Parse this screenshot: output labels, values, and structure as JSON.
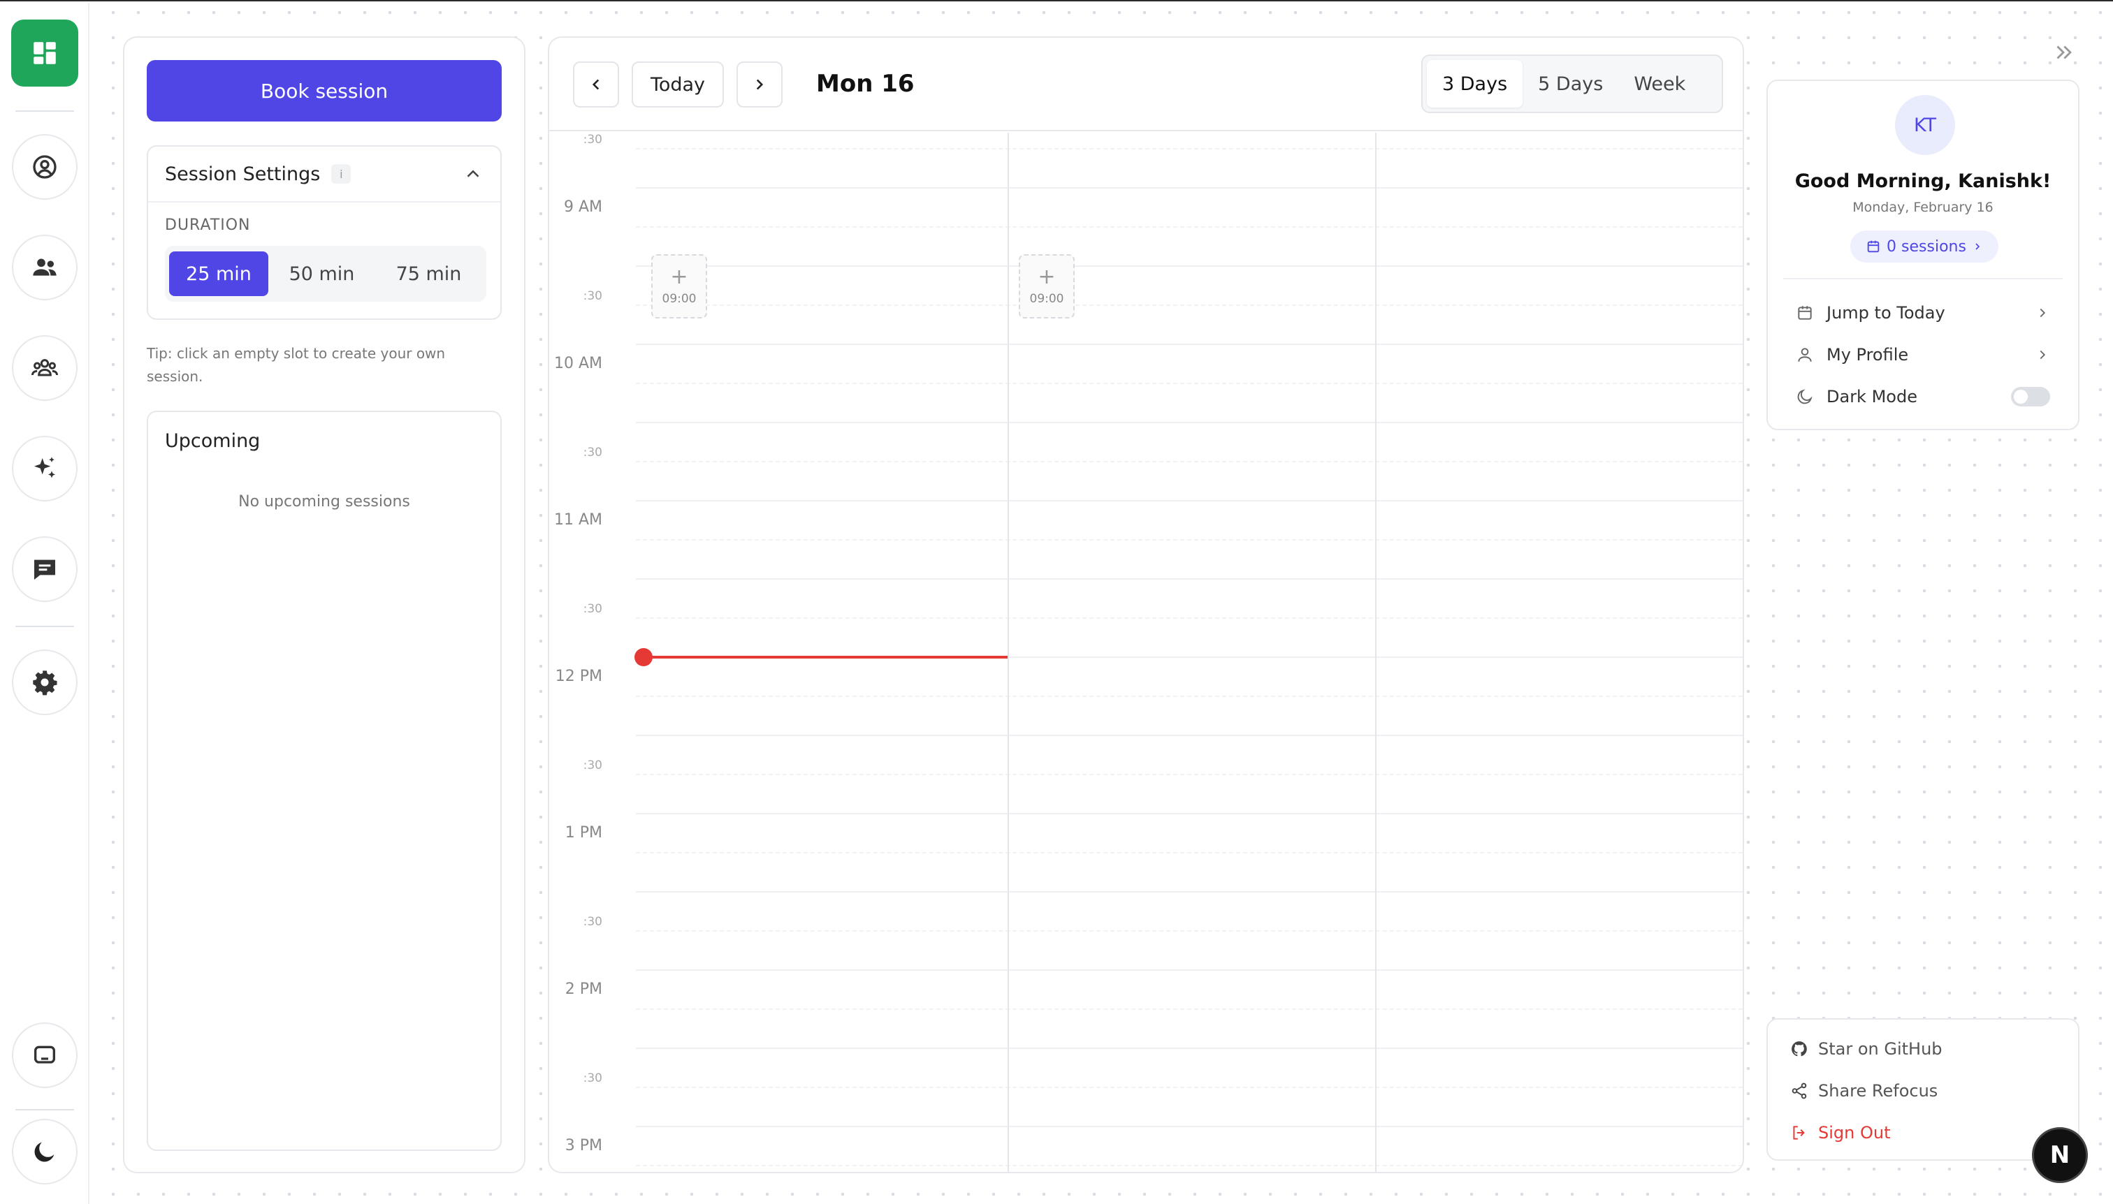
{
  "panel": {
    "book_label": "Book session",
    "settings_title": "Session Settings",
    "info_badge": "i",
    "duration_label": "DURATION",
    "durations": [
      "25 min",
      "50 min",
      "75 min"
    ],
    "duration_selected": "25 min",
    "tip": "Tip: click an empty slot to create your own session.",
    "upcoming_title": "Upcoming",
    "upcoming_empty": "No upcoming sessions"
  },
  "calendar": {
    "today_label": "Today",
    "date_title": "Mon 16",
    "views": [
      "3 Days",
      "5 Days",
      "Week"
    ],
    "view_selected": "3 Days",
    "time_labels": {
      "t0830": ":30",
      "t0900": "9 AM",
      "t0930": ":30",
      "t1000": "10 AM",
      "t1030": ":30",
      "t1100": "11 AM",
      "t1130": ":30",
      "t1200": "12 PM",
      "t1230": ":30",
      "t1300": "1 PM",
      "t1330": ":30",
      "t1400": "2 PM",
      "t1430": ":30",
      "t1500": "3 PM"
    },
    "slots": [
      {
        "plus": "+",
        "time": "09:00"
      },
      {
        "plus": "+",
        "time": "09:00"
      }
    ],
    "now_line_color": "#e53935"
  },
  "profile": {
    "initials": "KT",
    "greeting": "Good Morning, Kanishk!",
    "date": "Monday, February 16",
    "sessions": "0 sessions",
    "menu": {
      "jump_today": "Jump to Today",
      "my_profile": "My Profile",
      "dark_mode": "Dark Mode"
    },
    "dark_mode_on": false
  },
  "links": {
    "github": "Star on GitHub",
    "share": "Share Refocus",
    "signout": "Sign Out"
  },
  "badge": {
    "letter": "N"
  },
  "colors": {
    "accent": "#4f46e5",
    "brand_green": "#1fa65a",
    "danger": "#e53935"
  }
}
